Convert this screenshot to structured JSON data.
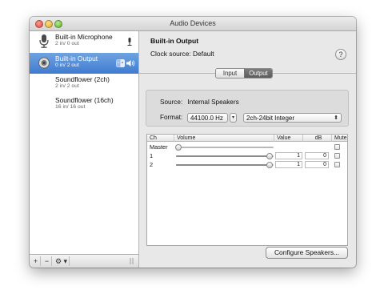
{
  "window": {
    "title": "Audio Devices"
  },
  "sidebar": {
    "devices": [
      {
        "name": "Built-in Microphone",
        "io": "2 in/ 0 out",
        "icon": "microphone-icon",
        "right_icon": "mic-default-input-icon",
        "selected": false
      },
      {
        "name": "Built-in Output",
        "io": "0 in/ 2 out",
        "icon": "speaker-icon",
        "right_icon": "output-default-icons",
        "selected": true
      },
      {
        "name": "Soundflower (2ch)",
        "io": "2 in/ 2 out",
        "selected": false
      },
      {
        "name": "Soundflower (16ch)",
        "io": "16 in/ 16 out",
        "selected": false
      }
    ],
    "bottom": {
      "add": "+",
      "remove": "−",
      "gear": "⚙ ▾"
    }
  },
  "main": {
    "device_name": "Built-in Output",
    "clock_source": "Clock source:  Default",
    "help": "?",
    "tabs": [
      {
        "label": "Input",
        "active": false
      },
      {
        "label": "Output",
        "active": true
      }
    ],
    "source_label": "Source:",
    "source_value": "Internal Speakers",
    "format_label": "Format:",
    "sample_rate": "44100.0 Hz",
    "bit_format": "2ch-24bit Integer",
    "table": {
      "headers": {
        "ch": "Ch",
        "volume": "Volume",
        "value": "Value",
        "db": "dB",
        "mute": "Mute"
      },
      "rows": [
        {
          "ch": "Master",
          "level": 0.0,
          "value": "",
          "db": "",
          "muted": false
        },
        {
          "ch": "1",
          "level": 1.0,
          "value": "1",
          "db": "0",
          "muted": false
        },
        {
          "ch": "2",
          "level": 1.0,
          "value": "1",
          "db": "0",
          "muted": false
        }
      ]
    },
    "configure_button": "Configure Speakers..."
  },
  "colors": {
    "selection": "#4a86d6",
    "window_bg": "#e8e8e8"
  }
}
